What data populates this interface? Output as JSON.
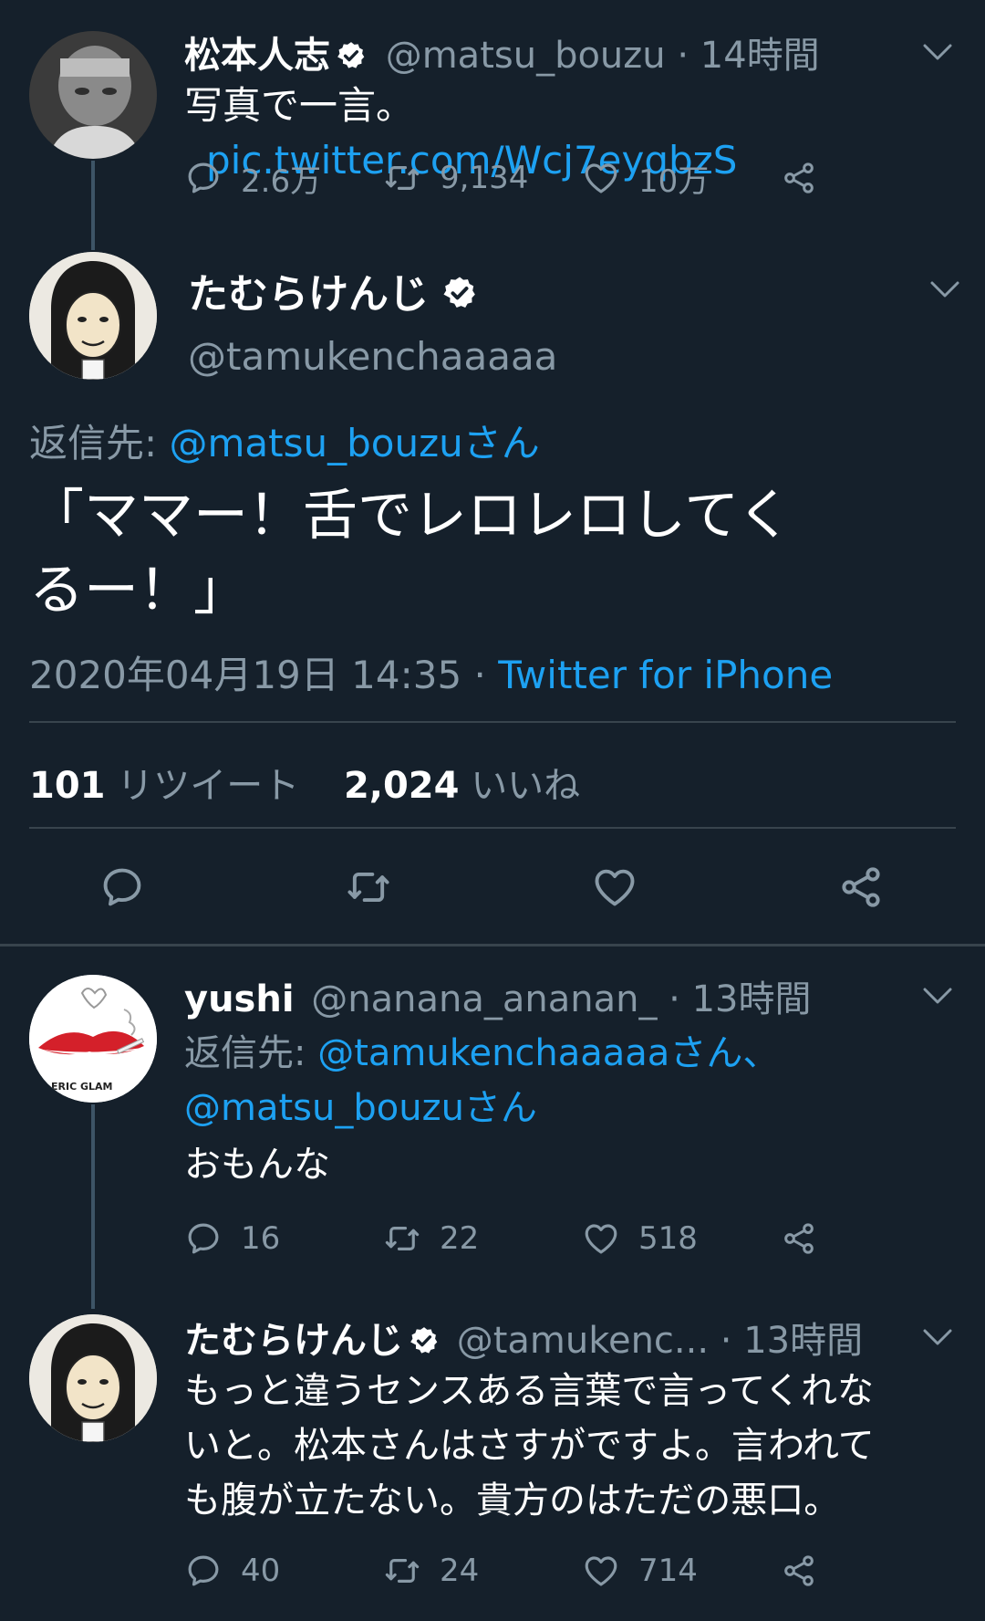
{
  "tweet1": {
    "name": "松本人志",
    "handle": "@matsu_bouzu",
    "time": "· 14時間",
    "text": "写真で一言。",
    "link": "pic.twitter.com/Wcj7eyqbzS",
    "replies": "2.6万",
    "retweets": "9,134",
    "likes": "10万"
  },
  "main": {
    "name": "たむらけんじ",
    "handle": "@tamukenchaaaaa",
    "reply_prefix": "返信先: ",
    "reply_to": "@matsu_bouzuさん",
    "text_line1": "「ママー！舌でレロレロしてく",
    "text_line2": "るー！」",
    "datetime": "2020年04月19日 14:35 · ",
    "source": "Twitter for iPhone",
    "retweet_count": "101",
    "retweet_label": "リツイート",
    "like_count": "2,024",
    "like_label": "いいね"
  },
  "reply1": {
    "name": "yushi",
    "handle": "@nanana_ananan_",
    "time": "· 13時間",
    "reply_prefix": "返信先: ",
    "reply_to_1": "@tamukenchaaaaaさん、",
    "reply_to_2": "@matsu_bouzuさん",
    "text": "おもんな",
    "replies": "16",
    "retweets": "22",
    "likes": "518",
    "avatar_text": "ERIC GLAM"
  },
  "reply2": {
    "name": "たむらけんじ",
    "handle": "@tamukenc...",
    "time": "· 13時間",
    "text_line1": "もっと違うセンスある言葉で言ってくれな",
    "text_line2": "いと。松本さんはさすがですよ。言われて",
    "text_line3": "も腹が立たない。貴方のはただの悪口。",
    "replies": "40",
    "retweets": "24",
    "likes": "714"
  },
  "colors": {
    "background": "#15202b",
    "accent": "#1da1f2",
    "muted": "#8899a6",
    "divider": "#38444d"
  },
  "icons": [
    "reply-icon",
    "retweet-icon",
    "like-icon",
    "share-icon",
    "verified-badge-icon",
    "chevron-down-icon"
  ]
}
